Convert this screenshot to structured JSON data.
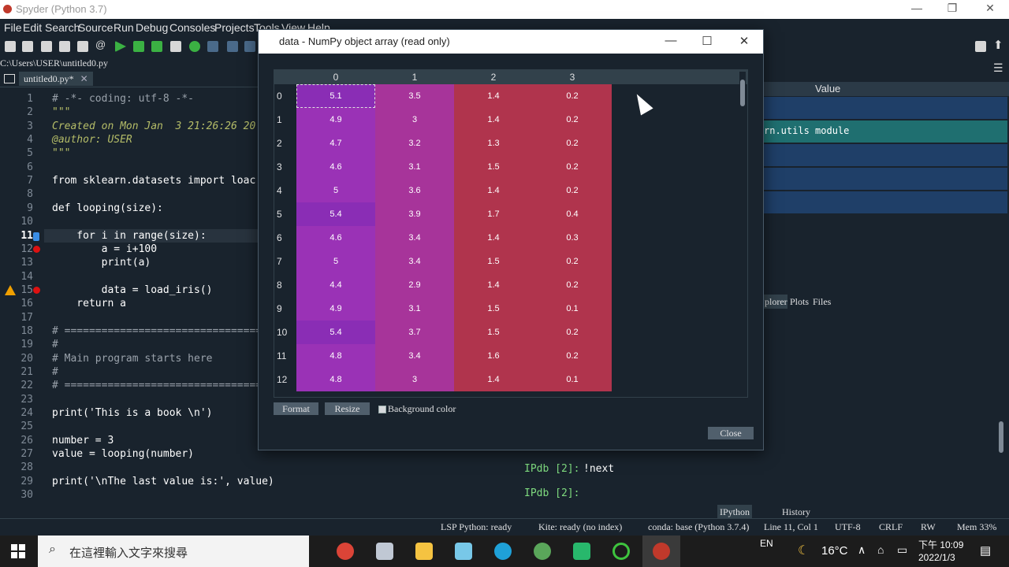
{
  "app": {
    "title": "Spyder (Python 3.7)"
  },
  "menu": [
    "File",
    "Edit",
    "Search",
    "Source",
    "Run",
    "Debug",
    "Consoles",
    "Projects",
    "Tools",
    "View",
    "Help"
  ],
  "editor": {
    "path": "C:\\Users\\USER\\untitled0.py",
    "tab_label": "untitled0.py*",
    "line_numbers": [
      "1",
      "2",
      "3",
      "4",
      "5",
      "6",
      "7",
      "8",
      "9",
      "10",
      "11",
      "12",
      "13",
      "14",
      "15",
      "16",
      "17",
      "18",
      "19",
      "20",
      "21",
      "22",
      "23",
      "24",
      "25",
      "26",
      "27",
      "28",
      "29",
      "30"
    ],
    "lines": [
      "# -*- coding: utf-8 -*-",
      "\"\"\"",
      "Created on Mon Jan  3 21:26:26 20",
      "@author: USER",
      "\"\"\"",
      "",
      "from sklearn.datasets import loac",
      "",
      "def looping(size):",
      "",
      "    for i in range(size):",
      "        a = i+100",
      "        print(a)",
      "",
      "        data = load_iris()",
      "    return a",
      "",
      "# ================================",
      "#",
      "# Main program starts here",
      "#",
      "# ================================",
      "",
      "print('This is a book \\n')",
      "",
      "number = 3",
      "value = looping(number)",
      "",
      "print('\\nThe last value is:', value)",
      ""
    ]
  },
  "variable_explorer": {
    "header_value": "Value",
    "module_text": "rn.utils module",
    "tabs": [
      "plorer",
      "Plots",
      "Files"
    ]
  },
  "console": {
    "prompt1": "IPdb [2]:",
    "cmd1": "!next",
    "prompt2": "IPdb [2]:",
    "tabs": [
      "IPython console",
      "History"
    ]
  },
  "dialog": {
    "title": "data - NumPy object array (read only)",
    "columns": [
      "0",
      "1",
      "2",
      "3"
    ],
    "rows": [
      "0",
      "1",
      "2",
      "3",
      "4",
      "5",
      "6",
      "7",
      "8",
      "9",
      "10",
      "11",
      "12"
    ],
    "cells": [
      [
        "5.1",
        "3.5",
        "1.4",
        "0.2"
      ],
      [
        "4.9",
        "3",
        "1.4",
        "0.2"
      ],
      [
        "4.7",
        "3.2",
        "1.3",
        "0.2"
      ],
      [
        "4.6",
        "3.1",
        "1.5",
        "0.2"
      ],
      [
        "5",
        "3.6",
        "1.4",
        "0.2"
      ],
      [
        "5.4",
        "3.9",
        "1.7",
        "0.4"
      ],
      [
        "4.6",
        "3.4",
        "1.4",
        "0.3"
      ],
      [
        "5",
        "3.4",
        "1.5",
        "0.2"
      ],
      [
        "4.4",
        "2.9",
        "1.4",
        "0.2"
      ],
      [
        "4.9",
        "3.1",
        "1.5",
        "0.1"
      ],
      [
        "5.4",
        "3.7",
        "1.5",
        "0.2"
      ],
      [
        "4.8",
        "3.4",
        "1.6",
        "0.2"
      ],
      [
        "4.8",
        "3",
        "1.4",
        "0.1"
      ]
    ],
    "format_button": "Format",
    "resize_button": "Resize",
    "background_color_label": "Background color",
    "close_button": "Close"
  },
  "status": {
    "lsp": "LSP Python: ready",
    "kite": "Kite: ready (no index)",
    "conda": "conda: base (Python 3.7.4)",
    "position": "Line 11, Col 1",
    "encoding": "UTF-8",
    "eol": "CRLF",
    "rw": "RW",
    "mem": "Mem 33%"
  },
  "taskbar": {
    "search_placeholder": "在這裡輸入文字來搜尋",
    "lang": "EN",
    "temp": "16°C",
    "time": "下午 10:09",
    "date": "2022/1/3"
  },
  "colors": {
    "background": "#19232d",
    "heat_purple": "#8e2fb8",
    "heat_magenta": "#a7349a",
    "heat_red": "#b0344d"
  }
}
